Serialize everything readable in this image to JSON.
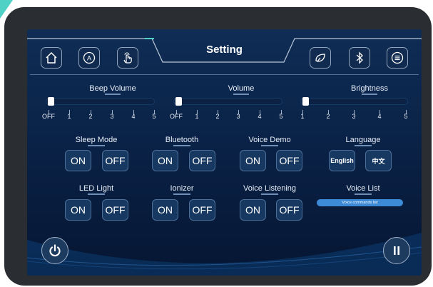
{
  "header": {
    "title": "Setting",
    "left_icons": [
      "home-icon",
      "auto-mode-icon",
      "touch-hand-icon"
    ],
    "right_icons": [
      "leaf-icon",
      "bluetooth-icon",
      "list-settings-icon"
    ]
  },
  "sliders": [
    {
      "label": "Beep Volume",
      "ticks": [
        "OFF",
        "1",
        "2",
        "3",
        "4",
        "5"
      ],
      "value": "OFF"
    },
    {
      "label": "Volume",
      "ticks": [
        "OFF",
        "1",
        "2",
        "3",
        "4",
        "5"
      ],
      "value": "OFF"
    },
    {
      "label": "Brightness",
      "ticks": [
        "1",
        "2",
        "3",
        "4",
        "5"
      ],
      "value": "1"
    }
  ],
  "groups": {
    "sleep_mode": {
      "label": "Sleep Mode",
      "on": "ON",
      "off": "OFF"
    },
    "bluetooth": {
      "label": "Bluetooth",
      "on": "ON",
      "off": "OFF"
    },
    "voice_demo": {
      "label": "Voice Demo",
      "on": "ON",
      "off": "OFF"
    },
    "language": {
      "label": "Language",
      "english": "English",
      "chinese": "中文"
    },
    "led_light": {
      "label": "LED Light",
      "on": "ON",
      "off": "OFF"
    },
    "ionizer": {
      "label": "Ionizer",
      "on": "ON",
      "off": "OFF"
    },
    "voice_listening": {
      "label": "Voice Listening",
      "on": "ON",
      "off": "OFF"
    },
    "voice_list": {
      "label": "Voice List",
      "button": "Voice commands list"
    }
  },
  "footer": {
    "left_icon": "power-icon",
    "right_icon": "pause-icon"
  },
  "colors": {
    "accent": "#4fd1c5",
    "screen_bg": "#0f2d55",
    "button_bg": "#173860",
    "voice_list_btn": "#3d8ad6"
  }
}
